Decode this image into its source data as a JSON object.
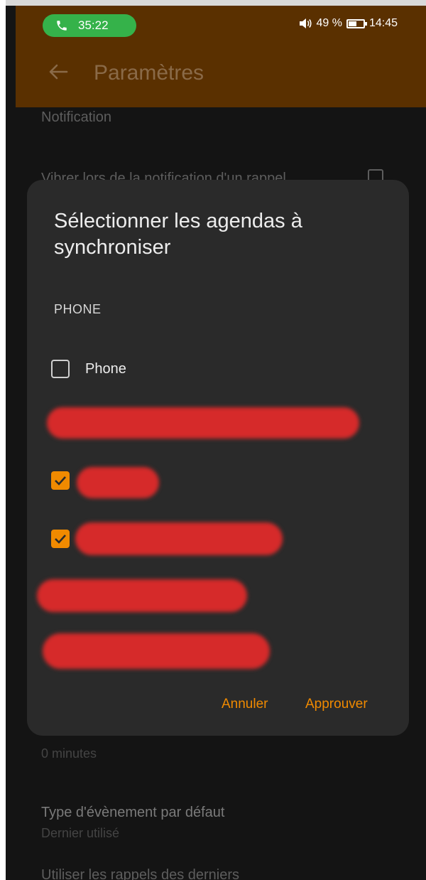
{
  "status_bar": {
    "call_timer": "35:22",
    "volume_icon": "volume-icon",
    "battery_percent": "49 %",
    "battery_level": 0.49,
    "time": "14:45"
  },
  "app_bar": {
    "back_icon": "arrow-left-icon",
    "title": "Paramètres",
    "background_color": "#5a3000"
  },
  "settings_behind": {
    "section_notification": "Notification",
    "vibrate_label": "Vibrer lors de la notification d'un rappel",
    "reminder_value": "0 minutes",
    "default_event_type_label": "Type d'évènement par défaut",
    "default_event_type_value": "Dernier utilisé",
    "use_last_reminders_label": "Utiliser les rappels des derniers"
  },
  "dialog": {
    "title": "Sélectionner les agendas à synchroniser",
    "section_phone": "PHONE",
    "items": [
      {
        "label": "Phone",
        "checked": false
      }
    ],
    "redacted_checked_items": [
      true,
      true
    ],
    "cancel_label": "Annuler",
    "approve_label": "Approuver",
    "accent_color": "#f08a00"
  }
}
